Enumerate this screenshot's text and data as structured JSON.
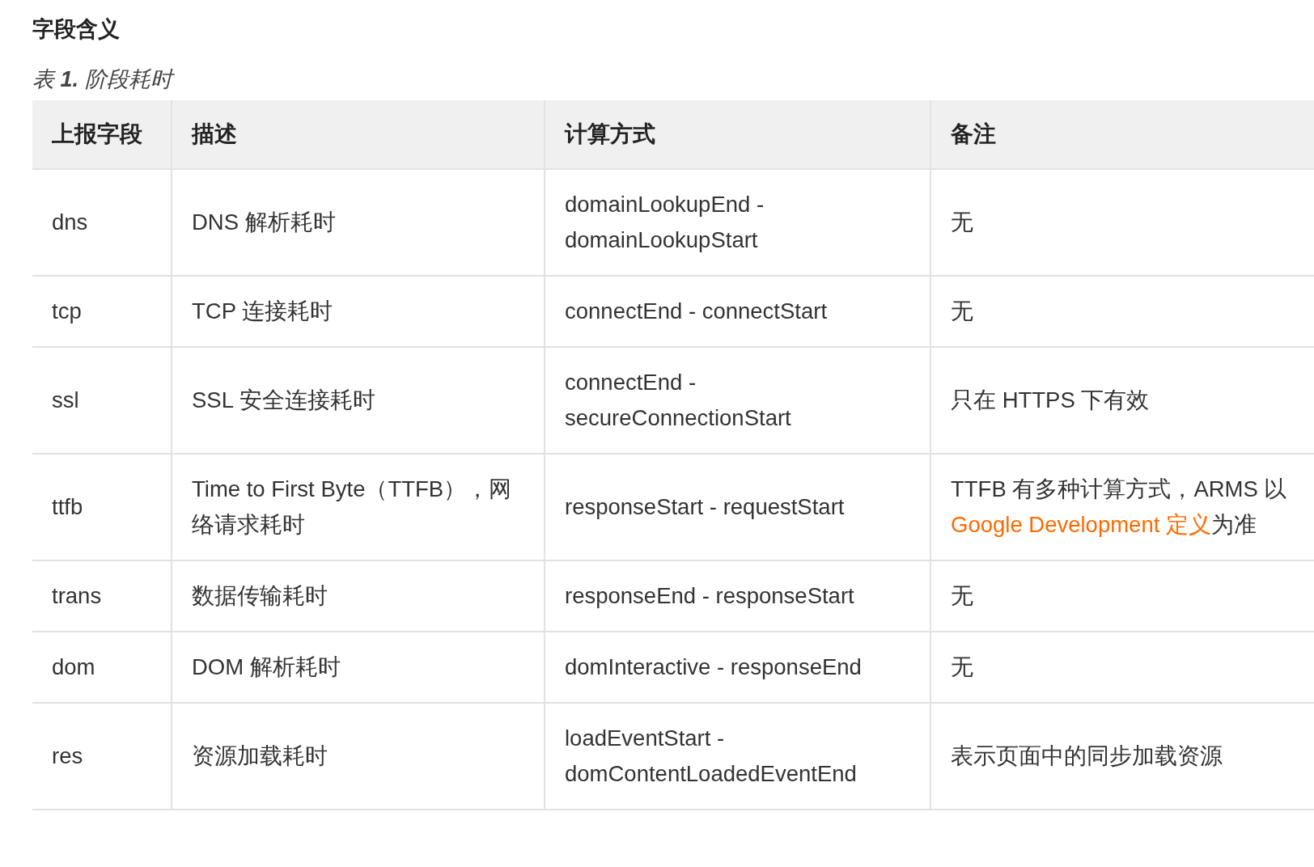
{
  "heading": "字段含义",
  "caption": "表 **1.** 阶段耗时",
  "table": {
    "columns": [
      "上报字段",
      "描述",
      "计算方式",
      "备注"
    ],
    "rows": [
      {
        "field": "dns",
        "description": "DNS 解析耗时",
        "formula": "domainLookupEnd - domainLookupStart",
        "note": "无"
      },
      {
        "field": "tcp",
        "description": "TCP 连接耗时",
        "formula": "connectEnd - connectStart",
        "note": "无"
      },
      {
        "field": "ssl",
        "description": "SSL 安全连接耗时",
        "formula": "connectEnd - secureConnectionStart",
        "note": "只在 HTTPS 下有效"
      },
      {
        "field": "ttfb",
        "description": "Time to First Byte（TTFB），网络请求耗时",
        "formula": "responseStart - requestStart",
        "note": "TTFB 有多种计算方式，ARMS 以 ",
        "note_link": "Google Development 定义",
        "note_after": "为准"
      },
      {
        "field": "trans",
        "description": "数据传输耗时",
        "formula": "responseEnd - responseStart",
        "note": "无"
      },
      {
        "field": "dom",
        "description": "DOM 解析耗时",
        "formula": "domInteractive - responseEnd",
        "note": "无"
      },
      {
        "field": "res",
        "description": "资源加载耗时",
        "formula": "loadEventStart - domContentLoadedEventEnd",
        "note": "表示页面中的同步加载资源"
      }
    ]
  }
}
